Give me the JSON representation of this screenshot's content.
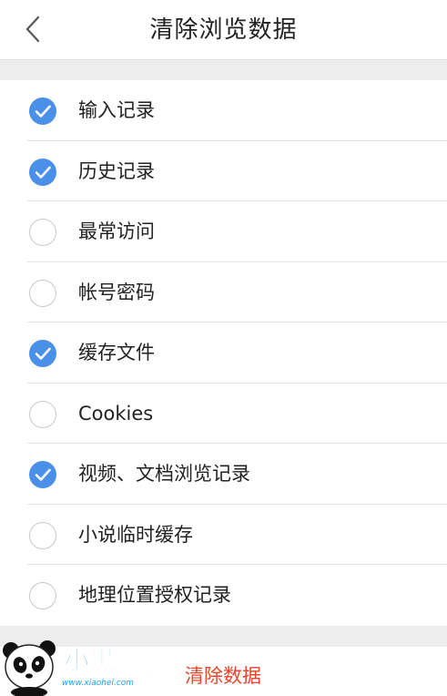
{
  "header": {
    "title": "清除浏览数据",
    "back_icon": "chevron-left-icon"
  },
  "items": [
    {
      "label": "输入记录",
      "checked": true
    },
    {
      "label": "历史记录",
      "checked": true
    },
    {
      "label": "最常访问",
      "checked": false
    },
    {
      "label": "帐号密码",
      "checked": false
    },
    {
      "label": "缓存文件",
      "checked": true
    },
    {
      "label": "Cookies",
      "checked": false
    },
    {
      "label": "视频、文档浏览记录",
      "checked": true
    },
    {
      "label": "小说临时缓存",
      "checked": false
    },
    {
      "label": "地理位置授权记录",
      "checked": false
    }
  ],
  "footer": {
    "clear_label": "清除数据"
  },
  "watermark": {
    "logo_text": "小黑游戏",
    "url": "www.xiaohei.com"
  },
  "colors": {
    "accent": "#4a90e8",
    "danger": "#e8452c",
    "divider": "#e3e3e3",
    "section_bg": "#ededed"
  }
}
